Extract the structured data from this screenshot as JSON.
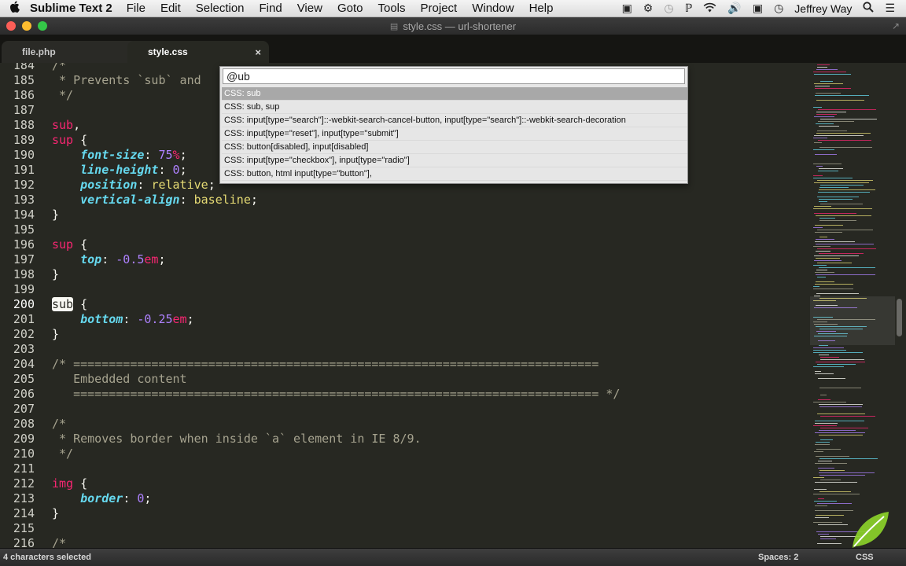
{
  "menubar": {
    "apple_icon": "apple-icon",
    "app_name": "Sublime Text 2",
    "items": [
      "File",
      "Edit",
      "Selection",
      "Find",
      "View",
      "Goto",
      "Tools",
      "Project",
      "Window",
      "Help"
    ],
    "user": "Jeffrey Way"
  },
  "window": {
    "title": "style.css — url-shortener"
  },
  "tabs": [
    {
      "label": "file.php",
      "dirty": true
    },
    {
      "label": "style.css",
      "close": "×"
    }
  ],
  "goto": {
    "query": "@ub",
    "items": [
      "CSS: sub",
      "CSS: sub, sup",
      "CSS: input[type=\"search\"]::-webkit-search-cancel-button, input[type=\"search\"]::-webkit-search-decoration",
      "CSS: input[type=\"reset\"], input[type=\"submit\"]",
      "CSS: button[disabled], input[disabled]",
      "CSS: input[type=\"checkbox\"], input[type=\"radio\"]",
      "CSS: button, html input[type=\"button\"],"
    ],
    "selected_index": 0
  },
  "editor": {
    "line_numbers": [
      "184",
      "185",
      "186",
      "187",
      "188",
      "189",
      "190",
      "191",
      "192",
      "193",
      "194",
      "195",
      "196",
      "197",
      "198",
      "199",
      "200",
      "201",
      "202",
      "203",
      "204",
      "205",
      "206",
      "207",
      "208",
      "209",
      "210",
      "211",
      "212",
      "213",
      "214",
      "215",
      "216"
    ],
    "current_line": "200",
    "lines": {
      "l184": "/*",
      "l185": " * Prevents `sub` and",
      "l186": " */",
      "l188_sel": "sub",
      "l188_rest": ",",
      "l189_sel": "sup",
      "l189_rest": " {",
      "l190_prop": "font-size",
      "l190_colon": ": ",
      "l190_num": "75",
      "l190_unit": "%",
      "l190_end": ";",
      "l191_prop": "line-height",
      "l191_colon": ": ",
      "l191_num": "0",
      "l191_end": ";",
      "l192_prop": "position",
      "l192_colon": ": ",
      "l192_val": "relative",
      "l192_end": ";",
      "l193_prop": "vertical-align",
      "l193_colon": ": ",
      "l193_val": "baseline",
      "l193_end": ";",
      "l194": "}",
      "l196_sel": "sup",
      "l196_rest": " {",
      "l197_prop": "top",
      "l197_colon": ": ",
      "l197_num": "-0.5",
      "l197_unit": "em",
      "l197_end": ";",
      "l198": "}",
      "l200_sel": "sub",
      "l200_rest": " {",
      "l201_prop": "bottom",
      "l201_colon": ": ",
      "l201_num": "-0.25",
      "l201_unit": "em",
      "l201_end": ";",
      "l202": "}",
      "l204": "/* ==========================================================================",
      "l205": "   Embedded content",
      "l206": "   ========================================================================== */",
      "l208": "/*",
      "l209": " * Removes border when inside `a` element in IE 8/9.",
      "l210": " */",
      "l212_sel": "img",
      "l212_rest": " {",
      "l213_prop": "border",
      "l213_colon": ": ",
      "l213_num": "0",
      "l213_end": ";",
      "l214": "}",
      "l216": "/*"
    }
  },
  "statusbar": {
    "selection": "4 characters selected",
    "spaces": "Spaces: 2",
    "syntax": "CSS"
  },
  "colors": {
    "background": "#272822",
    "keyword": "#f92672",
    "property": "#66d9ef",
    "value": "#e6db74",
    "number": "#ae81ff",
    "comment": "#a6a38f",
    "watermark": "#8bd12a"
  }
}
